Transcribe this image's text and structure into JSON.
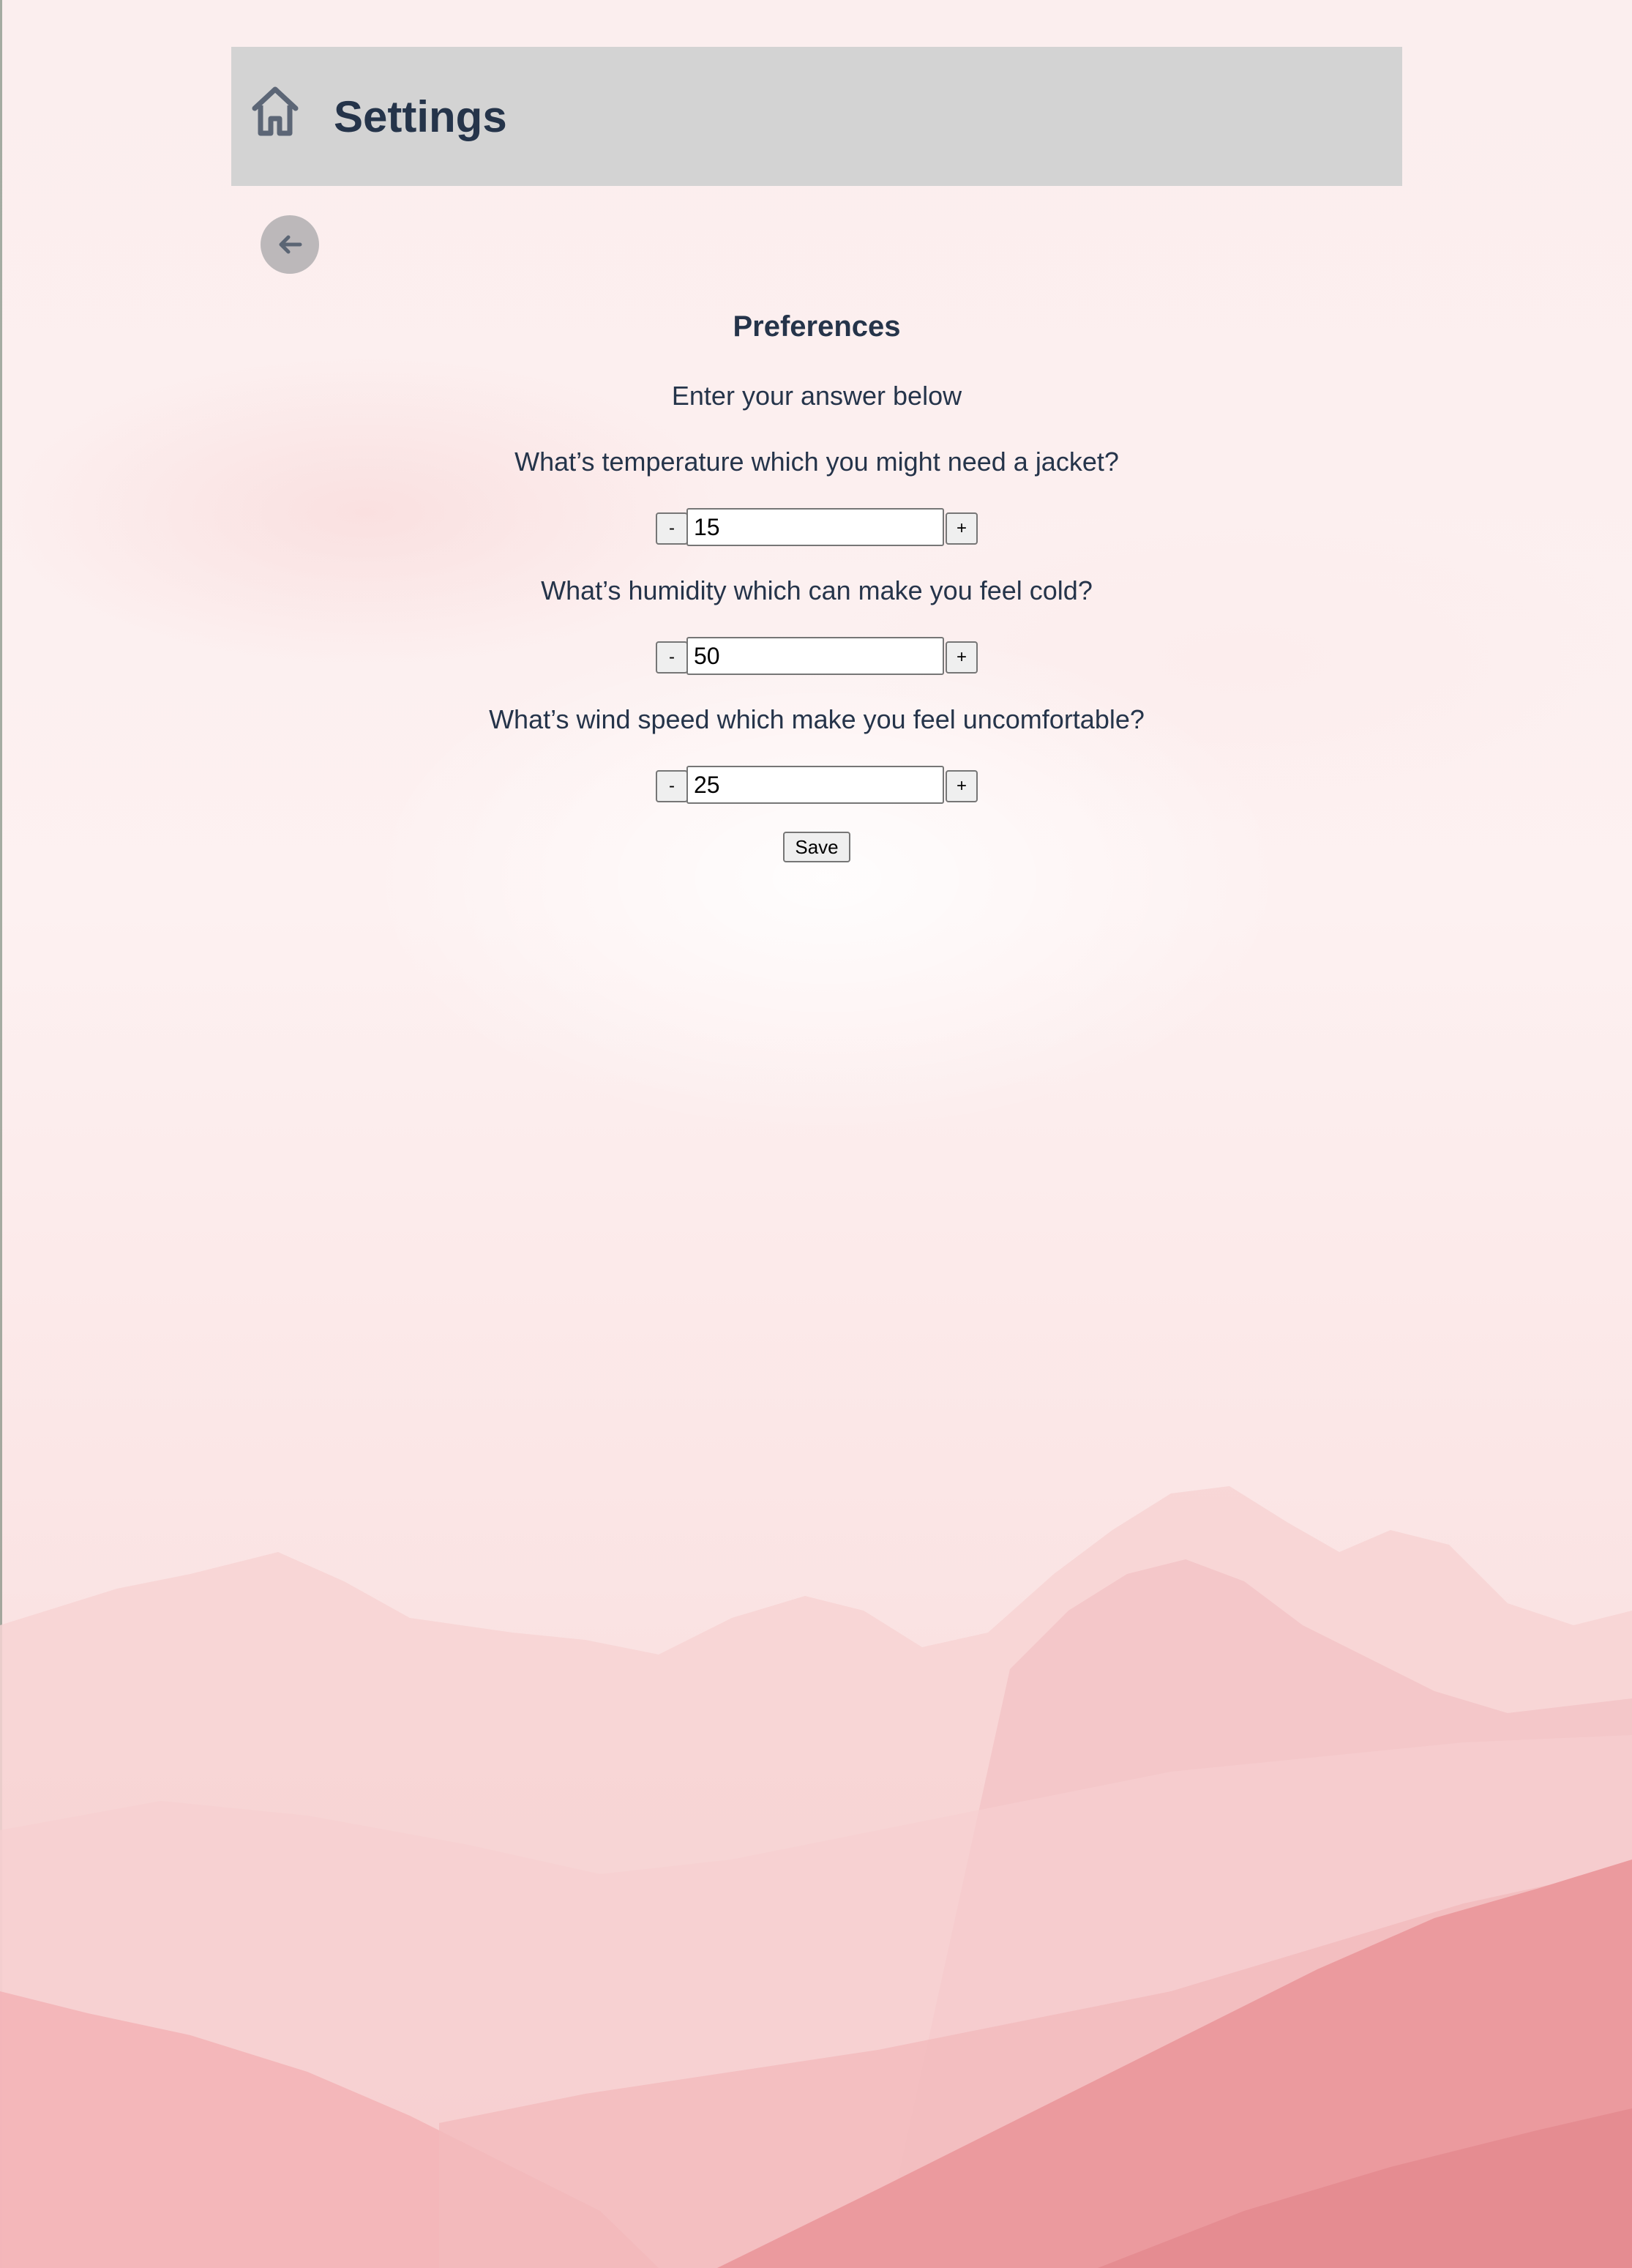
{
  "header": {
    "title": "Settings",
    "home_icon": "home-icon",
    "background_color": "#d3d3d3"
  },
  "back_button": {
    "icon": "arrow-left-icon"
  },
  "preferences": {
    "title": "Preferences",
    "subtitle": "Enter your answer below",
    "questions": [
      {
        "label": "What’s temperature which you might need a jacket?",
        "value": "15",
        "decrement_label": "-",
        "increment_label": "+"
      },
      {
        "label": "What’s humidity which can make you feel cold?",
        "value": "50",
        "decrement_label": "-",
        "increment_label": "+"
      },
      {
        "label": "What’s wind speed which make you feel uncomfortable?",
        "value": "25",
        "decrement_label": "-",
        "increment_label": "+"
      }
    ],
    "save_label": "Save"
  },
  "colors": {
    "text": "#25344a",
    "background_tint": "#fbeeee",
    "mountain_pink": "#f0a3a6"
  }
}
